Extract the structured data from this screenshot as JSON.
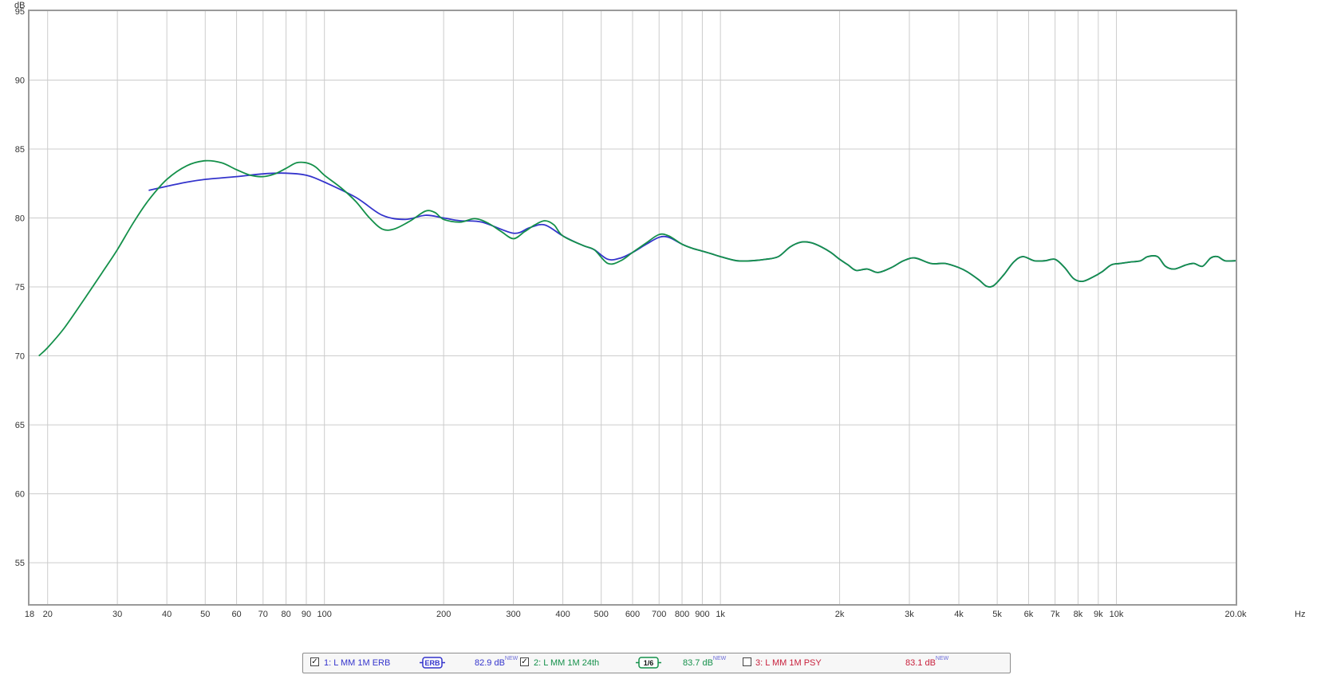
{
  "chart_data": {
    "type": "line",
    "y_unit": "dB",
    "x_unit": "Hz",
    "xscale": "log",
    "xlim": [
      18,
      20000
    ],
    "ylim": [
      52,
      95
    ],
    "grid": true,
    "y_ticks": [
      95,
      90,
      85,
      80,
      75,
      70,
      65,
      60,
      55
    ],
    "x_ticks": [
      {
        "v": 18,
        "label": "18"
      },
      {
        "v": 20,
        "label": "20"
      },
      {
        "v": 30,
        "label": "30"
      },
      {
        "v": 40,
        "label": "40"
      },
      {
        "v": 50,
        "label": "50"
      },
      {
        "v": 60,
        "label": "60"
      },
      {
        "v": 70,
        "label": "70"
      },
      {
        "v": 80,
        "label": "80"
      },
      {
        "v": 90,
        "label": "90"
      },
      {
        "v": 100,
        "label": "100"
      },
      {
        "v": 200,
        "label": "200"
      },
      {
        "v": 300,
        "label": "300"
      },
      {
        "v": 400,
        "label": "400"
      },
      {
        "v": 500,
        "label": "500"
      },
      {
        "v": 600,
        "label": "600"
      },
      {
        "v": 700,
        "label": "700"
      },
      {
        "v": 800,
        "label": "800"
      },
      {
        "v": 900,
        "label": "900"
      },
      {
        "v": 1000,
        "label": "1k"
      },
      {
        "v": 2000,
        "label": "2k"
      },
      {
        "v": 3000,
        "label": "3k"
      },
      {
        "v": 4000,
        "label": "4k"
      },
      {
        "v": 5000,
        "label": "5k"
      },
      {
        "v": 6000,
        "label": "6k"
      },
      {
        "v": 7000,
        "label": "7k"
      },
      {
        "v": 8000,
        "label": "8k"
      },
      {
        "v": 9000,
        "label": "9k"
      },
      {
        "v": 10000,
        "label": "10k"
      },
      {
        "v": 20000,
        "label": "20.0k"
      }
    ],
    "series": [
      {
        "name": "1: L MM 1M ERB",
        "color": "#3434cc",
        "points": [
          [
            36,
            82.0
          ],
          [
            40,
            82.3
          ],
          [
            45,
            82.6
          ],
          [
            50,
            82.8
          ],
          [
            60,
            83.0
          ],
          [
            70,
            83.2
          ],
          [
            80,
            83.25
          ],
          [
            90,
            83.1
          ],
          [
            100,
            82.6
          ],
          [
            120,
            81.5
          ],
          [
            140,
            80.2
          ],
          [
            160,
            79.9
          ],
          [
            180,
            80.2
          ],
          [
            200,
            80.0
          ],
          [
            220,
            79.8
          ],
          [
            250,
            79.7
          ],
          [
            300,
            78.9
          ],
          [
            330,
            79.3
          ],
          [
            360,
            79.5
          ],
          [
            400,
            78.7
          ],
          [
            450,
            78.0
          ],
          [
            480,
            77.7
          ],
          [
            520,
            77.0
          ],
          [
            560,
            77.1
          ],
          [
            600,
            77.5
          ],
          [
            650,
            78.1
          ],
          [
            700,
            78.6
          ],
          [
            740,
            78.6
          ],
          [
            800,
            78.1
          ],
          [
            850,
            77.8
          ],
          [
            900,
            77.6
          ],
          [
            950,
            77.4
          ],
          [
            1000,
            77.2
          ],
          [
            1100,
            76.9
          ],
          [
            1200,
            76.9
          ],
          [
            1300,
            77.0
          ],
          [
            1400,
            77.2
          ],
          [
            1500,
            77.9
          ],
          [
            1600,
            78.25
          ],
          [
            1700,
            78.2
          ],
          [
            1800,
            77.9
          ],
          [
            1900,
            77.5
          ],
          [
            2000,
            77.0
          ],
          [
            2100,
            76.6
          ],
          [
            2200,
            76.2
          ],
          [
            2350,
            76.3
          ],
          [
            2500,
            76.05
          ],
          [
            2700,
            76.4
          ],
          [
            2900,
            76.9
          ],
          [
            3100,
            77.1
          ],
          [
            3400,
            76.7
          ],
          [
            3700,
            76.7
          ],
          [
            4000,
            76.4
          ],
          [
            4200,
            76.1
          ],
          [
            4500,
            75.5
          ],
          [
            4700,
            75.05
          ],
          [
            4900,
            75.1
          ],
          [
            5200,
            75.9
          ],
          [
            5500,
            76.8
          ],
          [
            5800,
            77.2
          ],
          [
            6200,
            76.9
          ],
          [
            6600,
            76.9
          ],
          [
            7000,
            77.0
          ],
          [
            7400,
            76.4
          ],
          [
            7800,
            75.6
          ],
          [
            8200,
            75.4
          ],
          [
            8700,
            75.7
          ],
          [
            9200,
            76.1
          ],
          [
            9700,
            76.6
          ],
          [
            10200,
            76.7
          ],
          [
            10800,
            76.8
          ],
          [
            11500,
            76.9
          ],
          [
            12000,
            77.2
          ],
          [
            12700,
            77.2
          ],
          [
            13300,
            76.5
          ],
          [
            14000,
            76.3
          ],
          [
            15000,
            76.6
          ],
          [
            15700,
            76.7
          ],
          [
            16500,
            76.5
          ],
          [
            17300,
            77.1
          ],
          [
            18000,
            77.2
          ],
          [
            18800,
            76.9
          ],
          [
            20000,
            76.9
          ]
        ]
      },
      {
        "name": "2: L MM 1M 24th",
        "color": "#14904a",
        "points": [
          [
            19,
            70.0
          ],
          [
            20,
            70.6
          ],
          [
            22,
            72.0
          ],
          [
            25,
            74.3
          ],
          [
            28,
            76.4
          ],
          [
            30,
            77.7
          ],
          [
            33,
            79.7
          ],
          [
            36,
            81.3
          ],
          [
            40,
            82.8
          ],
          [
            45,
            83.8
          ],
          [
            50,
            84.15
          ],
          [
            55,
            84.0
          ],
          [
            60,
            83.5
          ],
          [
            65,
            83.1
          ],
          [
            70,
            83.0
          ],
          [
            75,
            83.2
          ],
          [
            80,
            83.6
          ],
          [
            85,
            84.0
          ],
          [
            90,
            84.0
          ],
          [
            95,
            83.7
          ],
          [
            100,
            83.1
          ],
          [
            110,
            82.2
          ],
          [
            120,
            81.2
          ],
          [
            130,
            80.0
          ],
          [
            140,
            79.2
          ],
          [
            150,
            79.2
          ],
          [
            165,
            79.8
          ],
          [
            180,
            80.5
          ],
          [
            190,
            80.4
          ],
          [
            200,
            79.9
          ],
          [
            220,
            79.7
          ],
          [
            240,
            79.95
          ],
          [
            260,
            79.6
          ],
          [
            280,
            79.0
          ],
          [
            300,
            78.5
          ],
          [
            320,
            79.0
          ],
          [
            340,
            79.5
          ],
          [
            360,
            79.8
          ],
          [
            380,
            79.5
          ],
          [
            400,
            78.7
          ],
          [
            450,
            78.0
          ],
          [
            480,
            77.7
          ],
          [
            520,
            76.7
          ],
          [
            560,
            76.9
          ],
          [
            600,
            77.5
          ],
          [
            650,
            78.2
          ],
          [
            700,
            78.8
          ],
          [
            740,
            78.7
          ],
          [
            800,
            78.1
          ],
          [
            850,
            77.8
          ],
          [
            900,
            77.6
          ],
          [
            950,
            77.4
          ],
          [
            1000,
            77.2
          ],
          [
            1100,
            76.9
          ],
          [
            1200,
            76.9
          ],
          [
            1300,
            77.0
          ],
          [
            1400,
            77.2
          ],
          [
            1500,
            77.9
          ],
          [
            1600,
            78.25
          ],
          [
            1700,
            78.2
          ],
          [
            1800,
            77.9
          ],
          [
            1900,
            77.5
          ],
          [
            2000,
            77.0
          ],
          [
            2100,
            76.6
          ],
          [
            2200,
            76.2
          ],
          [
            2350,
            76.3
          ],
          [
            2500,
            76.05
          ],
          [
            2700,
            76.4
          ],
          [
            2900,
            76.9
          ],
          [
            3100,
            77.1
          ],
          [
            3400,
            76.7
          ],
          [
            3700,
            76.7
          ],
          [
            4000,
            76.4
          ],
          [
            4200,
            76.1
          ],
          [
            4500,
            75.5
          ],
          [
            4700,
            75.05
          ],
          [
            4900,
            75.1
          ],
          [
            5200,
            75.9
          ],
          [
            5500,
            76.8
          ],
          [
            5800,
            77.2
          ],
          [
            6200,
            76.9
          ],
          [
            6600,
            76.9
          ],
          [
            7000,
            77.0
          ],
          [
            7400,
            76.4
          ],
          [
            7800,
            75.6
          ],
          [
            8200,
            75.4
          ],
          [
            8700,
            75.7
          ],
          [
            9200,
            76.1
          ],
          [
            9700,
            76.6
          ],
          [
            10200,
            76.7
          ],
          [
            10800,
            76.8
          ],
          [
            11500,
            76.9
          ],
          [
            12000,
            77.2
          ],
          [
            12700,
            77.2
          ],
          [
            13300,
            76.5
          ],
          [
            14000,
            76.3
          ],
          [
            15000,
            76.6
          ],
          [
            15700,
            76.7
          ],
          [
            16500,
            76.5
          ],
          [
            17300,
            77.1
          ],
          [
            18000,
            77.2
          ],
          [
            18800,
            76.9
          ],
          [
            20000,
            76.9
          ]
        ]
      }
    ]
  },
  "legend": {
    "items": [
      {
        "name": "1: L MM 1M ERB",
        "checked": true,
        "badge": "ERB",
        "value": "82.9 dB",
        "tag": "NEW",
        "color": "#3434cc"
      },
      {
        "name": "2: L MM 1M 24th",
        "checked": true,
        "badge": "1/6",
        "value": "83.7 dB",
        "tag": "NEW",
        "color": "#14904a"
      },
      {
        "name": "3: L MM 1M PSY",
        "checked": false,
        "badge": "",
        "value": "83.1 dB",
        "tag": "NEW",
        "color": "#c8203c"
      }
    ]
  }
}
